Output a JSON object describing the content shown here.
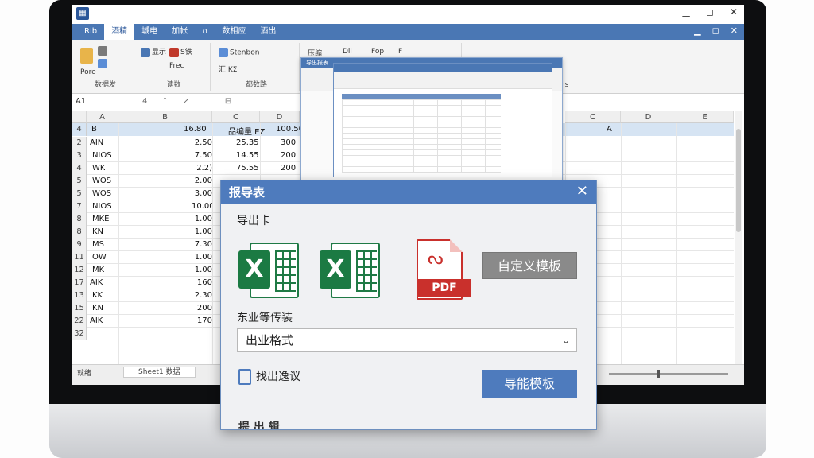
{
  "window": {
    "app_icon": "excel-app-icon",
    "controls": [
      "▁",
      "◻",
      "✕"
    ]
  },
  "ribbon": {
    "tabs": [
      "Rib",
      "酒精",
      "城电",
      "加帐",
      "∩",
      "数相应",
      "酒出"
    ],
    "active_tab": 1,
    "ribbon_ctrls": [
      "▁",
      "◻",
      "✕"
    ],
    "groups": [
      {
        "label": "数据发",
        "items": [
          "Pore"
        ]
      },
      {
        "label": "读数",
        "items": [
          "显示",
          "S铁",
          "Frec"
        ]
      },
      {
        "label": "都数路",
        "items": [
          "Stenbon",
          "汇 KΣ"
        ]
      },
      {
        "label": "",
        "items": [
          "压缩",
          "Dil",
          "Fop",
          "F"
        ]
      }
    ],
    "right_label": "hs"
  },
  "formula": {
    "cell_ref": "A1",
    "fx_items": [
      "4",
      "↑",
      "↗",
      "⊥",
      "⊟"
    ]
  },
  "grid": {
    "col_headers": [
      "A",
      "B",
      "C",
      "D",
      "E",
      "C",
      "D",
      "E"
    ],
    "header_row": {
      "row": "4",
      "b": "B",
      "c": "16.80",
      "d": "品编量 EZ",
      "e": "100.50",
      "f": "A"
    },
    "rows": [
      {
        "num": "2",
        "name": "AIN",
        "c": "2.50",
        "d": "25.35",
        "e": "300"
      },
      {
        "num": "3",
        "name": "INIOS",
        "c": "7.50",
        "d": "14.55",
        "e": "200"
      },
      {
        "num": "4",
        "name": "IWK",
        "c": "2.2)",
        "d": "75.55",
        "e": "200"
      },
      {
        "num": "5",
        "name": "IWOS",
        "c": "2.00",
        "d": "",
        "e": ""
      },
      {
        "num": "5",
        "name": "IWOS",
        "c": "3.00",
        "d": "",
        "e": ""
      },
      {
        "num": "7",
        "name": "INIOS",
        "c": "10.00",
        "d": "",
        "e": ""
      },
      {
        "num": "8",
        "name": "IMKE",
        "c": "1.00",
        "d": "",
        "e": ""
      },
      {
        "num": "8",
        "name": "IKN",
        "c": "1.00",
        "d": "",
        "e": ""
      },
      {
        "num": "9",
        "name": "IMS",
        "c": "7.30",
        "d": "",
        "e": ""
      },
      {
        "num": "11",
        "name": "IOW",
        "c": "1.00",
        "d": "",
        "e": ""
      },
      {
        "num": "12",
        "name": "IMK",
        "c": "1.00",
        "d": "",
        "e": ""
      },
      {
        "num": "17",
        "name": "AIK",
        "c": "160",
        "d": "",
        "e": ""
      },
      {
        "num": "13",
        "name": "IKK",
        "c": "2.30",
        "d": "",
        "e": ""
      },
      {
        "num": "15",
        "name": "IKN",
        "c": "200",
        "d": "",
        "e": ""
      },
      {
        "num": "22",
        "name": "AIK",
        "c": "170",
        "d": "",
        "e": ""
      },
      {
        "num": "32",
        "name": "",
        "c": "",
        "d": "",
        "e": ""
      }
    ]
  },
  "sheetbar": {
    "left_text": "就绪",
    "sheet_tab": "Sheet1 数据"
  },
  "thumbnail": {
    "title": "导出报表"
  },
  "dialog": {
    "title": "报导表",
    "section_label": "导出卡",
    "formats": [
      {
        "name": "excel-xlsx-icon",
        "letter": "X"
      },
      {
        "name": "excel-xls-icon",
        "letter": "X"
      },
      {
        "name": "pdf-icon",
        "letter": "PDF"
      }
    ],
    "custom_template_button": "自定义模板",
    "select_label": "东业等传装",
    "select_value": "出业格式",
    "link_text": "找出逸议",
    "primary_button": "导能模板",
    "footer_text": "提 出 辑"
  },
  "colors": {
    "ribbon_blue": "#4a77b4",
    "dialog_blue": "#4e7bbd",
    "excel_green": "#1f7a45",
    "pdf_red": "#c9302c",
    "highlight_row": "#d6e4f3"
  }
}
